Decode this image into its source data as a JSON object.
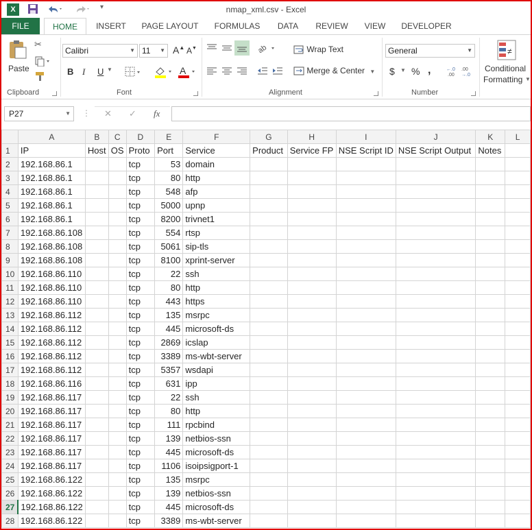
{
  "window": {
    "title": "nmap_xml.csv - Excel"
  },
  "tabs": [
    "HOME",
    "INSERT",
    "PAGE LAYOUT",
    "FORMULAS",
    "DATA",
    "REVIEW",
    "VIEW",
    "DEVELOPER"
  ],
  "file_tab": "FILE",
  "ribbon": {
    "paste": "Paste",
    "clipboard": "Clipboard",
    "font_name": "Calibri",
    "font_size": "11",
    "font": "Font",
    "bold": "B",
    "italic": "I",
    "underline": "U",
    "alignment": "Alignment",
    "wrap_text": "Wrap Text",
    "merge_center": "Merge & Center",
    "number_format": "General",
    "number": "Number",
    "currency": "$",
    "percent": "%",
    "comma": ",",
    "conditional_1": "Conditional",
    "conditional_2": "Formatting"
  },
  "formula_bar": {
    "name_box": "P27",
    "fx": "fx",
    "value": ""
  },
  "columns": [
    "",
    "A",
    "B",
    "C",
    "D",
    "E",
    "F",
    "G",
    "H",
    "I",
    "J",
    "K",
    "L"
  ],
  "selected_row": 27,
  "headers": [
    "IP",
    "Host",
    "OS",
    "Proto",
    "Port",
    "Service",
    "Product",
    "Service FP",
    "NSE Script ID",
    "NSE Script Output",
    "Notes",
    ""
  ],
  "rows": [
    [
      "192.168.86.1",
      "tcp",
      "53",
      "domain"
    ],
    [
      "192.168.86.1",
      "tcp",
      "80",
      "http"
    ],
    [
      "192.168.86.1",
      "tcp",
      "548",
      "afp"
    ],
    [
      "192.168.86.1",
      "tcp",
      "5000",
      "upnp"
    ],
    [
      "192.168.86.1",
      "tcp",
      "8200",
      "trivnet1"
    ],
    [
      "192.168.86.108",
      "tcp",
      "554",
      "rtsp"
    ],
    [
      "192.168.86.108",
      "tcp",
      "5061",
      "sip-tls"
    ],
    [
      "192.168.86.108",
      "tcp",
      "8100",
      "xprint-server"
    ],
    [
      "192.168.86.110",
      "tcp",
      "22",
      "ssh"
    ],
    [
      "192.168.86.110",
      "tcp",
      "80",
      "http"
    ],
    [
      "192.168.86.110",
      "tcp",
      "443",
      "https"
    ],
    [
      "192.168.86.112",
      "tcp",
      "135",
      "msrpc"
    ],
    [
      "192.168.86.112",
      "tcp",
      "445",
      "microsoft-ds"
    ],
    [
      "192.168.86.112",
      "tcp",
      "2869",
      "icslap"
    ],
    [
      "192.168.86.112",
      "tcp",
      "3389",
      "ms-wbt-server"
    ],
    [
      "192.168.86.112",
      "tcp",
      "5357",
      "wsdapi"
    ],
    [
      "192.168.86.116",
      "tcp",
      "631",
      "ipp"
    ],
    [
      "192.168.86.117",
      "tcp",
      "22",
      "ssh"
    ],
    [
      "192.168.86.117",
      "tcp",
      "80",
      "http"
    ],
    [
      "192.168.86.117",
      "tcp",
      "111",
      "rpcbind"
    ],
    [
      "192.168.86.117",
      "tcp",
      "139",
      "netbios-ssn"
    ],
    [
      "192.168.86.117",
      "tcp",
      "445",
      "microsoft-ds"
    ],
    [
      "192.168.86.117",
      "tcp",
      "1106",
      "isoipsigport-1"
    ],
    [
      "192.168.86.122",
      "tcp",
      "135",
      "msrpc"
    ],
    [
      "192.168.86.122",
      "tcp",
      "139",
      "netbios-ssn"
    ],
    [
      "192.168.86.122",
      "tcp",
      "445",
      "microsoft-ds"
    ],
    [
      "192.168.86.122",
      "tcp",
      "3389",
      "ms-wbt-server"
    ]
  ]
}
